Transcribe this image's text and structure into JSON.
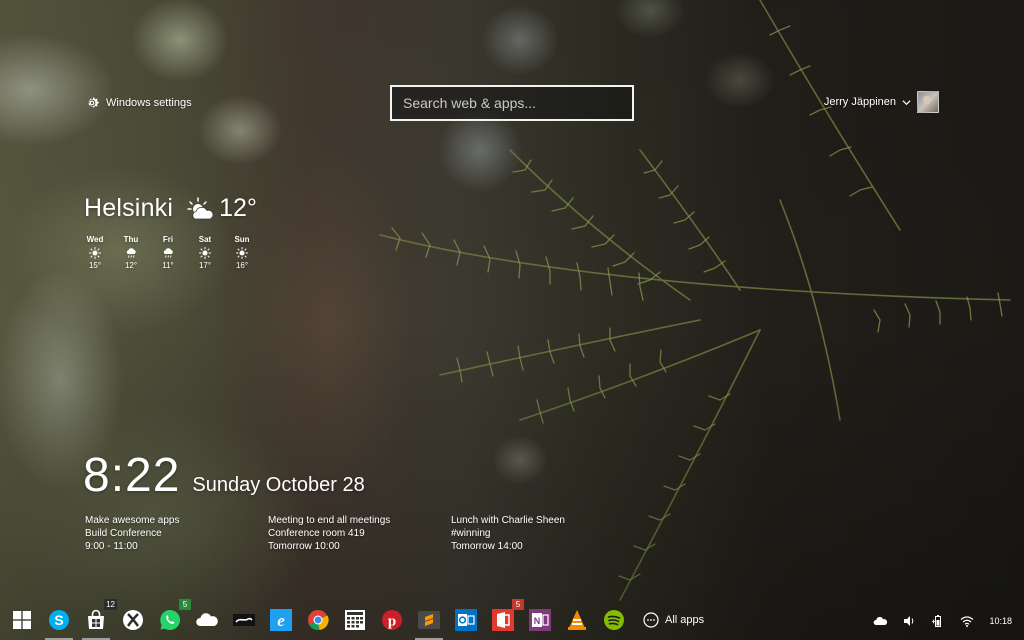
{
  "header": {
    "settings_label": "Windows settings",
    "search_placeholder": "Search web & apps...",
    "user_name": "Jerry Jäppinen"
  },
  "weather": {
    "city": "Helsinki",
    "current_temp": "12°",
    "current_icon": "partly-cloudy-icon",
    "forecast": [
      {
        "day": "Wed",
        "icon": "sun-icon",
        "temp": "15°"
      },
      {
        "day": "Thu",
        "icon": "rain-icon",
        "temp": "12°"
      },
      {
        "day": "Fri",
        "icon": "rain-icon",
        "temp": "11°"
      },
      {
        "day": "Sat",
        "icon": "sun-icon",
        "temp": "17°"
      },
      {
        "day": "Sun",
        "icon": "sun-icon",
        "temp": "16°"
      }
    ]
  },
  "clock": {
    "time": "8:22",
    "date": "Sunday October 28"
  },
  "events": [
    {
      "title": "Make awesome apps",
      "location": "Build Conference",
      "time": "9:00 - 11:00"
    },
    {
      "title": "Meeting to end all meetings",
      "location": "Conference room 419",
      "time": "Tomorrow 10:00"
    },
    {
      "title": "Lunch with Charlie Sheen",
      "location": "#winning",
      "time": "Tomorrow 14:00"
    }
  ],
  "taskbar": {
    "apps": [
      {
        "name": "windows-start-icon"
      },
      {
        "name": "skype-icon"
      },
      {
        "name": "store-icon",
        "badge": "12"
      },
      {
        "name": "xbox-icon"
      },
      {
        "name": "whatsapp-icon",
        "badge": "5"
      },
      {
        "name": "onedrive-icon"
      },
      {
        "name": "steam-icon"
      },
      {
        "name": "internet-explorer-icon"
      },
      {
        "name": "chrome-icon"
      },
      {
        "name": "calendar-icon"
      },
      {
        "name": "pinterest-icon"
      },
      {
        "name": "sublime-text-icon"
      },
      {
        "name": "outlook-icon"
      },
      {
        "name": "office-icon",
        "badge": "5"
      },
      {
        "name": "onenote-icon"
      },
      {
        "name": "vlc-icon"
      },
      {
        "name": "spotify-icon"
      }
    ],
    "all_apps_label": "All apps",
    "tray_time": "10:18",
    "tray_icons": [
      "onedrive-tray-icon",
      "volume-icon",
      "battery-icon",
      "wifi-icon"
    ]
  },
  "colors": {
    "skype": "#00aff0",
    "whatsapp": "#25d366",
    "ie": "#1ea1f1",
    "pinterest": "#cb2027",
    "outlook": "#0072c6",
    "office": "#e03a2f",
    "onenote": "#80397b",
    "vlc": "#f28c00",
    "spotify": "#84bd00"
  }
}
